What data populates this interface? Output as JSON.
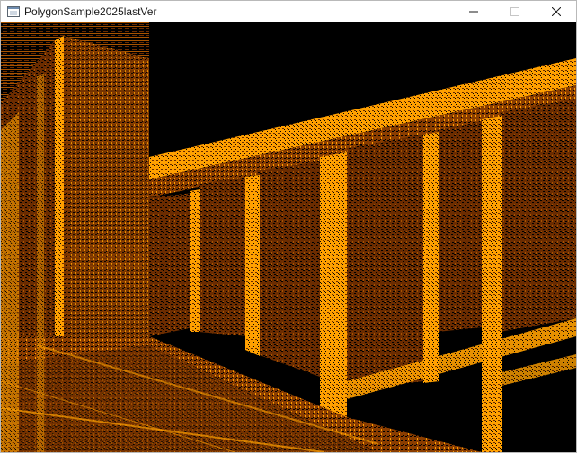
{
  "window": {
    "title": "PolygonSample2025lastVer"
  },
  "title_buttons": {
    "minimize": "minimize-icon",
    "maximize": "maximize-icon",
    "close": "close-icon"
  },
  "colors": {
    "accent": "#ffa000",
    "dark": "#6b2c00",
    "mid": "#a85400",
    "background": "#000000"
  }
}
